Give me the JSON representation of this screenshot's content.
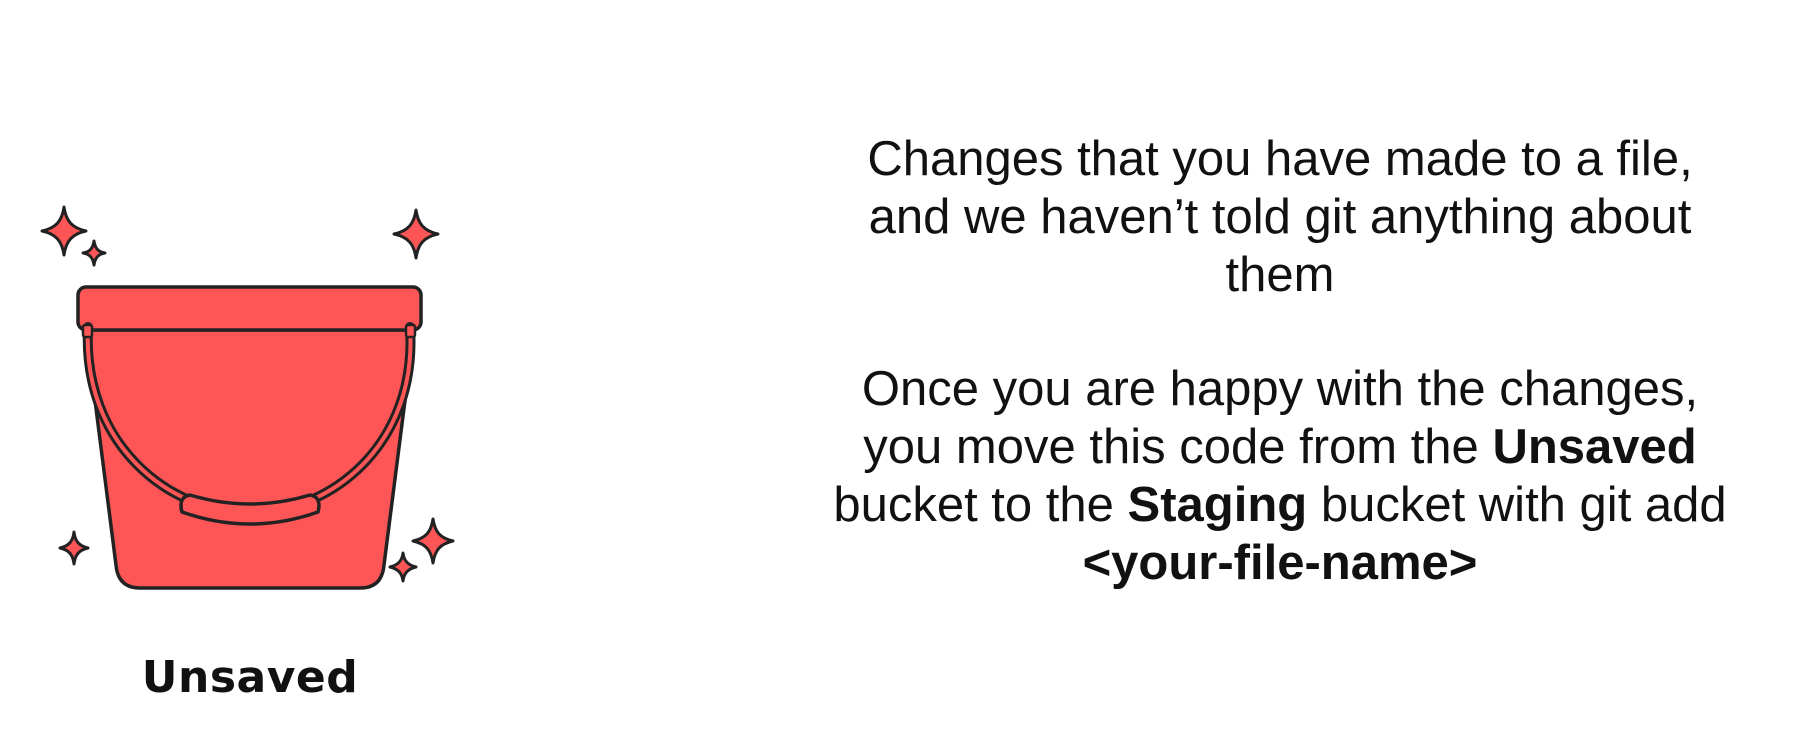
{
  "bucket": {
    "label": "Unsaved",
    "icon": "bucket-icon",
    "fill_color": "#fe5656",
    "outline_color": "#222222"
  },
  "description": {
    "para1": {
      "line1": "Changes that you have made to a file,",
      "line2": "and we haven’t told git anything about",
      "line3": "them"
    },
    "para2": {
      "line1": "Once you are happy with the changes,",
      "line2_text": "you move this code from the ",
      "line2_bold": "Unsaved",
      "line3_text_a": "bucket to the ",
      "line3_bold": "Staging",
      "line3_text_b": " bucket with git add",
      "line4_bold": "<your-file-name>"
    }
  }
}
